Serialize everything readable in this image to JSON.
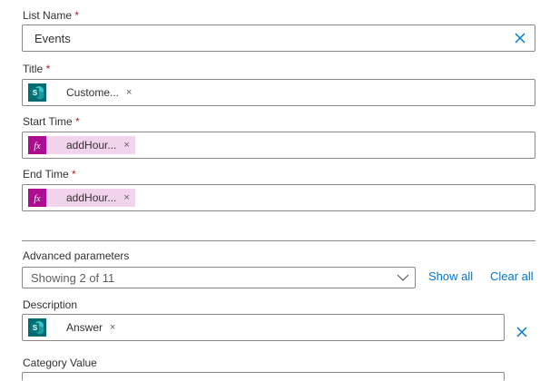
{
  "list_name": {
    "label": "List Name",
    "required_mark": "*",
    "value": "Events"
  },
  "title": {
    "label": "Title",
    "required_mark": "*",
    "token": {
      "text": "Custome...",
      "icon": "sharepoint-icon",
      "close": "×"
    }
  },
  "start_time": {
    "label": "Start Time",
    "required_mark": "*",
    "token": {
      "text": "addHour...",
      "icon": "fx-expression-icon",
      "close": "×"
    }
  },
  "end_time": {
    "label": "End Time",
    "required_mark": "*",
    "token": {
      "text": "addHour...",
      "icon": "fx-expression-icon",
      "close": "×"
    }
  },
  "advanced": {
    "label": "Advanced parameters",
    "selected": "Showing 2 of 11",
    "show_all": "Show all",
    "clear_all": "Clear all"
  },
  "description": {
    "label": "Description",
    "token": {
      "text": "Answer",
      "icon": "sharepoint-icon",
      "close": "×"
    }
  },
  "category_value": {
    "label": "Category Value"
  },
  "colors": {
    "accent": "#0078d4",
    "fx_token_bg": "#f1d4ec",
    "fx_icon_bg": "#ad0d90",
    "sp_icon_bg": "#036c70"
  }
}
